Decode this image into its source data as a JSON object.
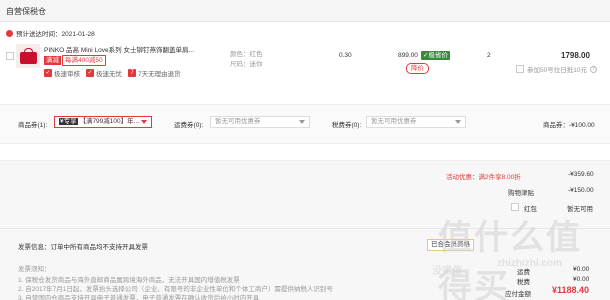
{
  "store": {
    "title": "自营保税仓",
    "delivery_time": "预计送达时间：2021-01-28"
  },
  "product": {
    "name": "PINKO 品高 Mini Love系列 女士铆钉燕饰翻盖单肩...",
    "promo_tag": "满减",
    "promo_text": "每满400减50",
    "services": [
      {
        "icon": "check",
        "label": "极速审核"
      },
      {
        "icon": "check",
        "label": "极速无忧"
      },
      {
        "icon": "seven",
        "label": "7天无理由退货"
      }
    ],
    "color_label": "颜色：红色",
    "size_label": "尺码：迷你",
    "weight": "0.30",
    "price": "899.00",
    "price_badge": "极省价",
    "price_drop_btn": "降价",
    "quantity": "2",
    "subtotal": "1798.00",
    "gift_opt": "参加50号拉日抵10元"
  },
  "coupons": {
    "goods_label": "商品券(1):",
    "goods_badge": "¥专享",
    "goods_value": "【满799减100】年...",
    "freight_label": "运费券(0):",
    "freight_placeholder": "暂无可用优惠券",
    "tax_label": "税费券(0):",
    "tax_placeholder": "暂无可用优惠券",
    "goods_total_label": "商品券：",
    "goods_total": "-¥100.00"
  },
  "summary": {
    "activity_label": "活动优惠：满2件享8.00折",
    "activity_value": "-¥359.60",
    "gift_label": "购物津贴",
    "gift_value": "-¥150.00",
    "redpack_label": "红包",
    "redpack_value": "暂无可用"
  },
  "invoice": {
    "title": "发票信息：订单中所有商品均不支持开具发票",
    "member_badge": "已合会员资格",
    "notes_title": "发票须知：",
    "notes": [
      "1. 保税仓发货商品与海外直邮商品属跨境海外商品，无法开具国内增值税发票",
      "2. 自2017年7月1日起，发票抬头选择公司（企业、有限号的非企业性单位和个体工商户）需提供纳税人识别号",
      "3. 自营国内仓商品支持开具电子普通发票，电子普通发票在确认收货后给小时内开具"
    ],
    "postage_label": "运费",
    "postage_value": "¥0.00",
    "tax_label": "税费",
    "tax_value": "¥0.00",
    "pay_label": "应付金额",
    "pay_value": "¥1188.40"
  },
  "watermark": {
    "site": "值什么值得买",
    "url": "zhizhizhi.com",
    "site_small": "没得值"
  }
}
